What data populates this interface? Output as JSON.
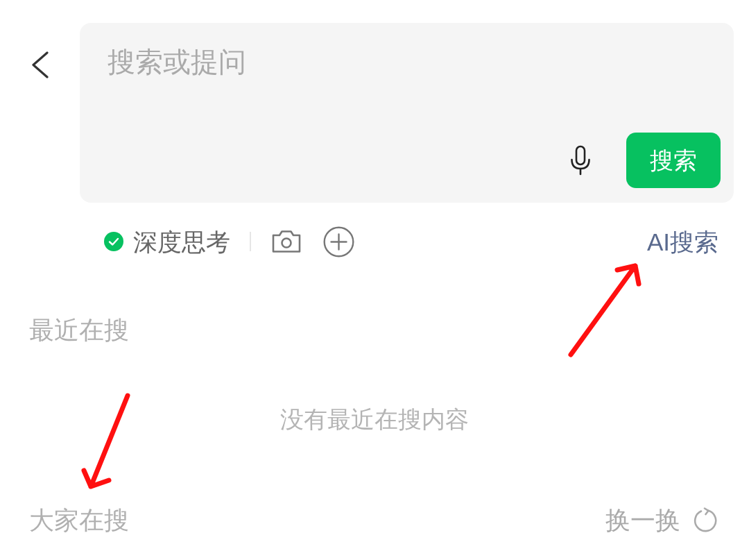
{
  "search": {
    "placeholder": "搜索或提问",
    "button_label": "搜索"
  },
  "options": {
    "deep_thinking": {
      "label": "深度思考",
      "checked": true
    },
    "ai_search_link": "AI搜索"
  },
  "recent_searches": {
    "title": "最近在搜",
    "empty_message": "没有最近在搜内容"
  },
  "popular_searches": {
    "title": "大家在搜",
    "refresh_label": "换一换"
  }
}
